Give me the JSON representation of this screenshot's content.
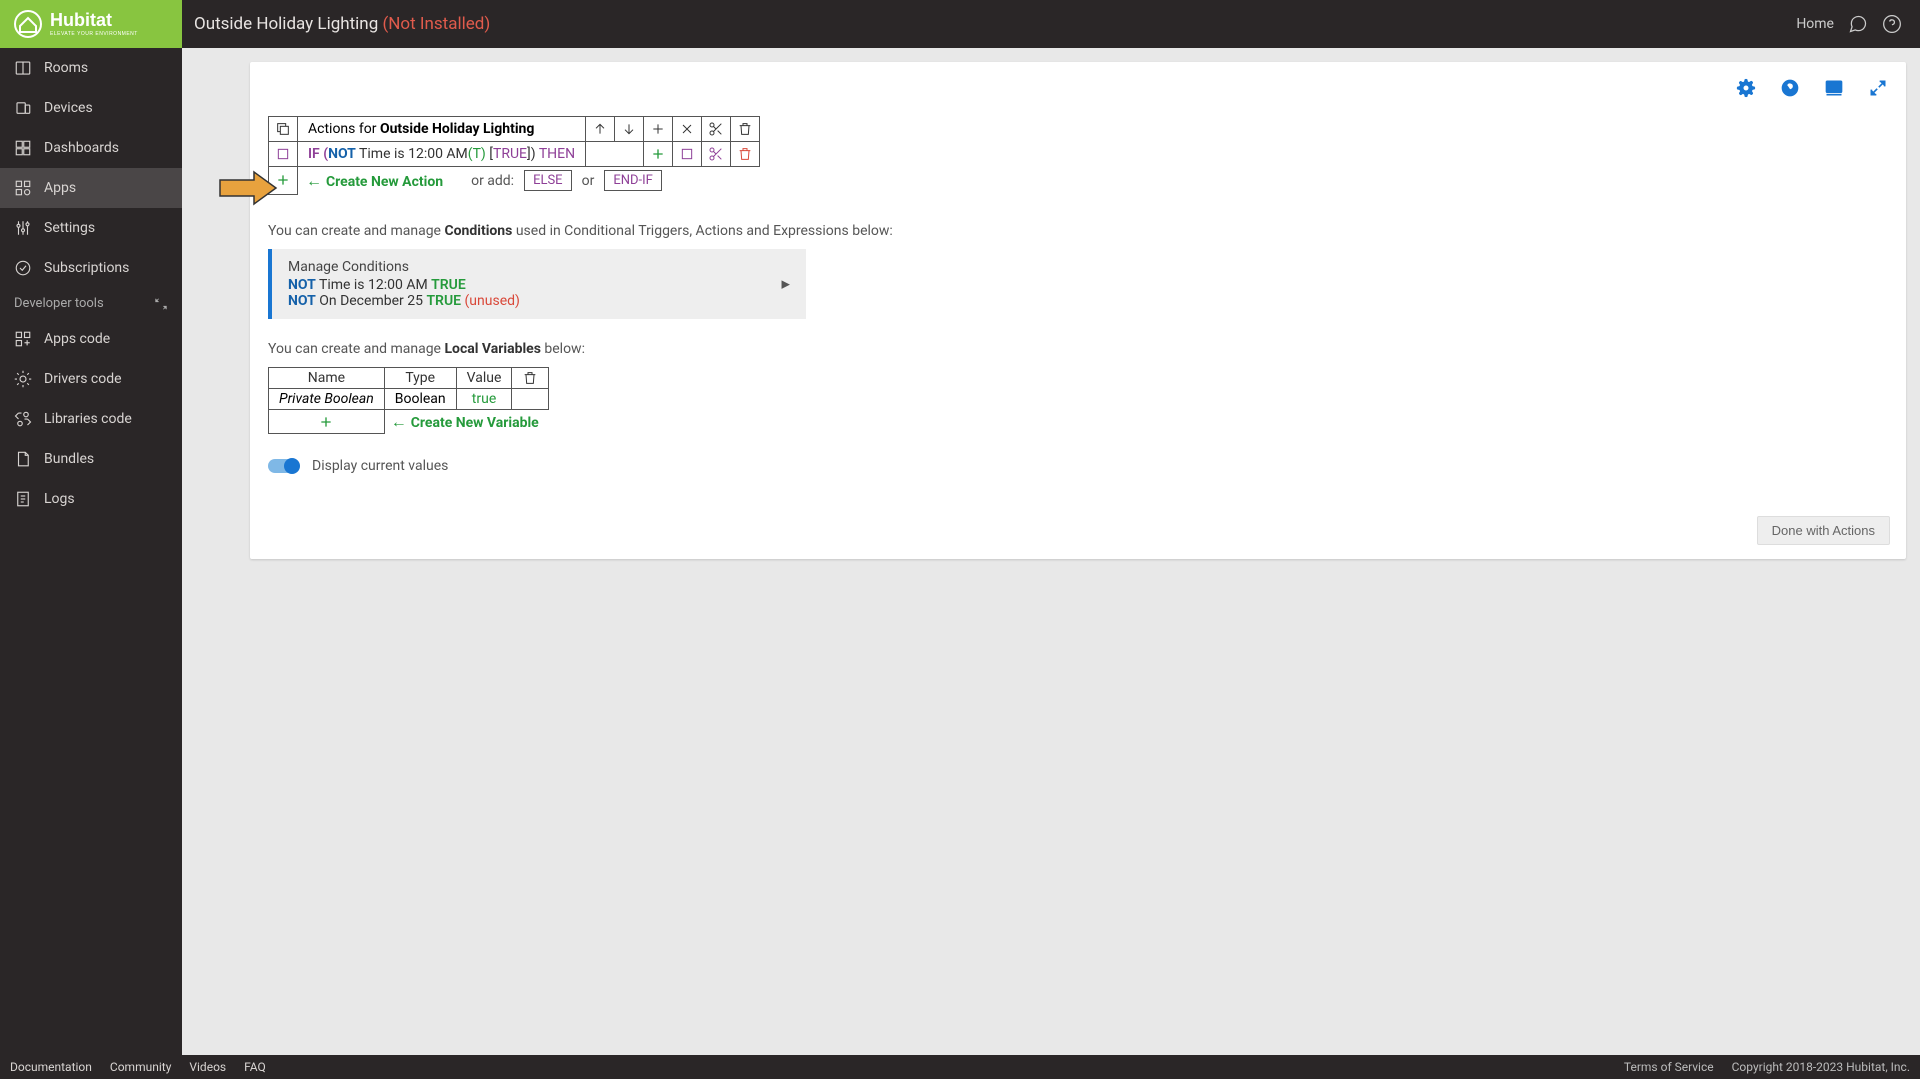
{
  "header": {
    "title_prefix": "Outside Holiday Lighting ",
    "title_suffix": "(Not Installed)",
    "home": "Home"
  },
  "sidebar": {
    "items": [
      {
        "label": "Rooms",
        "icon": "rooms"
      },
      {
        "label": "Devices",
        "icon": "devices"
      },
      {
        "label": "Dashboards",
        "icon": "dashboards"
      },
      {
        "label": "Apps",
        "icon": "apps",
        "active": true
      },
      {
        "label": "Settings",
        "icon": "settings"
      },
      {
        "label": "Subscriptions",
        "icon": "subscriptions"
      }
    ],
    "dev_heading": "Developer tools",
    "dev_items": [
      {
        "label": "Apps code",
        "icon": "appscode"
      },
      {
        "label": "Drivers code",
        "icon": "driverscode"
      },
      {
        "label": "Libraries code",
        "icon": "librariescode"
      },
      {
        "label": "Bundles",
        "icon": "bundles"
      },
      {
        "label": "Logs",
        "icon": "logs"
      }
    ]
  },
  "footer": {
    "links": [
      "Documentation",
      "Community",
      "Videos",
      "FAQ"
    ],
    "tos": "Terms of Service",
    "copyright": "Copyright 2018-2023 Hubitat, Inc."
  },
  "actions": {
    "header_prefix": "Actions for ",
    "header_bold": "Outside Holiday Lighting",
    "if_row": {
      "if": "IF (",
      "not": "NOT",
      "time": " Time is 12:00 AM",
      "t": "(T)",
      "lb": " [",
      "true": "TRUE",
      "rb": "]",
      "paren": ") ",
      "then": "THEN"
    },
    "create_new": "Create New Action",
    "or_add": "or add:",
    "else": "ELSE",
    "or": "or",
    "endif": "END-IF"
  },
  "conditions": {
    "help_prefix": "You can create and manage ",
    "help_bold": "Conditions",
    "help_suffix": " used in Conditional Triggers, Actions and Expressions below:",
    "title": "Manage Conditions",
    "lines": [
      {
        "not": "NOT",
        "txt": " Time is 12:00 AM ",
        "true": "TRUE",
        "unused": ""
      },
      {
        "not": "NOT",
        "txt": " On December 25 ",
        "true": "TRUE",
        "unused": " (unused)"
      }
    ]
  },
  "vars": {
    "help_prefix": "You can create and manage ",
    "help_bold": "Local Variables",
    "help_suffix": " below:",
    "headers": {
      "name": "Name",
      "type": "Type",
      "value": "Value"
    },
    "rows": [
      {
        "name": "Private Boolean",
        "type": "Boolean",
        "value": "true"
      }
    ],
    "create_new": "Create New Variable"
  },
  "toggle": {
    "label": "Display current values"
  },
  "done": "Done with Actions"
}
